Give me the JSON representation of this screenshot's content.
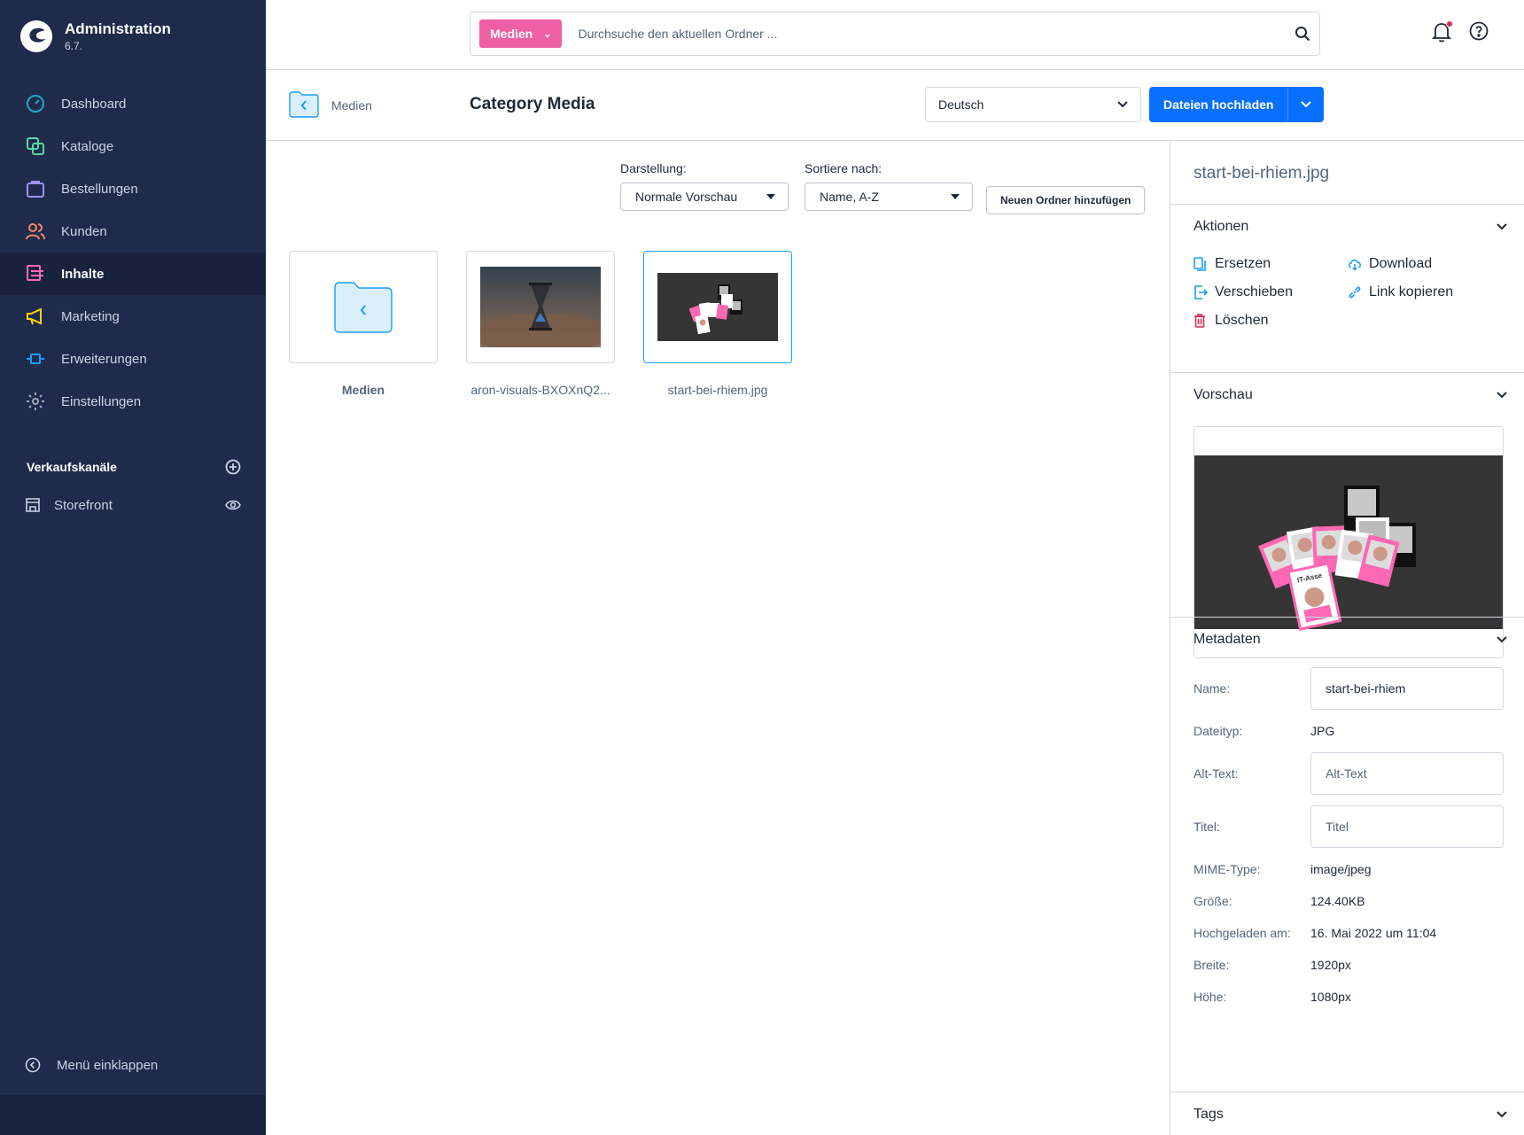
{
  "app": {
    "title": "Administration",
    "version": "6.7."
  },
  "sidebar": {
    "items": [
      {
        "label": "Dashboard",
        "icon": "dashboard-icon",
        "color": "#1fa7c9"
      },
      {
        "label": "Kataloge",
        "icon": "catalog-icon",
        "color": "#57d9a3"
      },
      {
        "label": "Bestellungen",
        "icon": "orders-icon",
        "color": "#a092f0"
      },
      {
        "label": "Kunden",
        "icon": "customers-icon",
        "color": "#f88962"
      },
      {
        "label": "Inhalte",
        "icon": "content-icon",
        "color": "#ff68b4",
        "active": true
      },
      {
        "label": "Marketing",
        "icon": "marketing-icon",
        "color": "#ffd700"
      },
      {
        "label": "Erweiterungen",
        "icon": "extensions-icon",
        "color": "#189eff"
      },
      {
        "label": "Einstellungen",
        "icon": "settings-icon",
        "color": "#9aa8b5"
      }
    ],
    "sales_channels_title": "Verkaufskanäle",
    "storefront_label": "Storefront",
    "collapse_label": "Menü einklappen"
  },
  "search": {
    "chip": "Medien",
    "placeholder": "Durchsuche den aktuellen Ordner ..."
  },
  "smartbar": {
    "breadcrumb": "Medien",
    "title": "Category Media",
    "language": "Deutsch",
    "upload_label": "Dateien hochladen"
  },
  "toolbar": {
    "view_label": "Darstellung:",
    "view_value": "Normale Vorschau",
    "sort_label": "Sortiere nach:",
    "sort_value": "Name, A-Z",
    "new_folder_label": "Neuen Ordner hinzufügen"
  },
  "media": [
    {
      "name": "Medien",
      "type": "folder"
    },
    {
      "name": "aron-visuals-BXOXnQ2...",
      "type": "image"
    },
    {
      "name": "start-bei-rhiem.jpg",
      "type": "image",
      "selected": true
    }
  ],
  "panel": {
    "filename": "start-bei-rhiem.jpg",
    "actions_title": "Aktionen",
    "actions": {
      "replace": "Ersetzen",
      "download": "Download",
      "move": "Verschieben",
      "copy_link": "Link kopieren",
      "delete": "Löschen"
    },
    "preview_title": "Vorschau",
    "preview_card_label": "IT-Asse",
    "metadata_title": "Metadaten",
    "meta": {
      "name_label": "Name:",
      "name_value": "start-bei-rhiem",
      "filetype_label": "Dateityp:",
      "filetype_value": "JPG",
      "alt_label": "Alt-Text:",
      "alt_placeholder": "Alt-Text",
      "title_label": "Titel:",
      "title_placeholder": "Titel",
      "mime_label": "MIME-Type:",
      "mime_value": "image/jpeg",
      "size_label": "Größe:",
      "size_value": "124.40KB",
      "uploaded_label": "Hochgeladen am:",
      "uploaded_value": "16. Mai 2022 um 11:04",
      "width_label": "Breite:",
      "width_value": "1920px",
      "height_label": "Höhe:",
      "height_value": "1080px"
    },
    "tags_title": "Tags"
  },
  "colors": {
    "brand_blue": "#0870ff",
    "pink": "#ee5fa4",
    "sidebar": "#1e2b4b",
    "notify": "#de294c"
  }
}
